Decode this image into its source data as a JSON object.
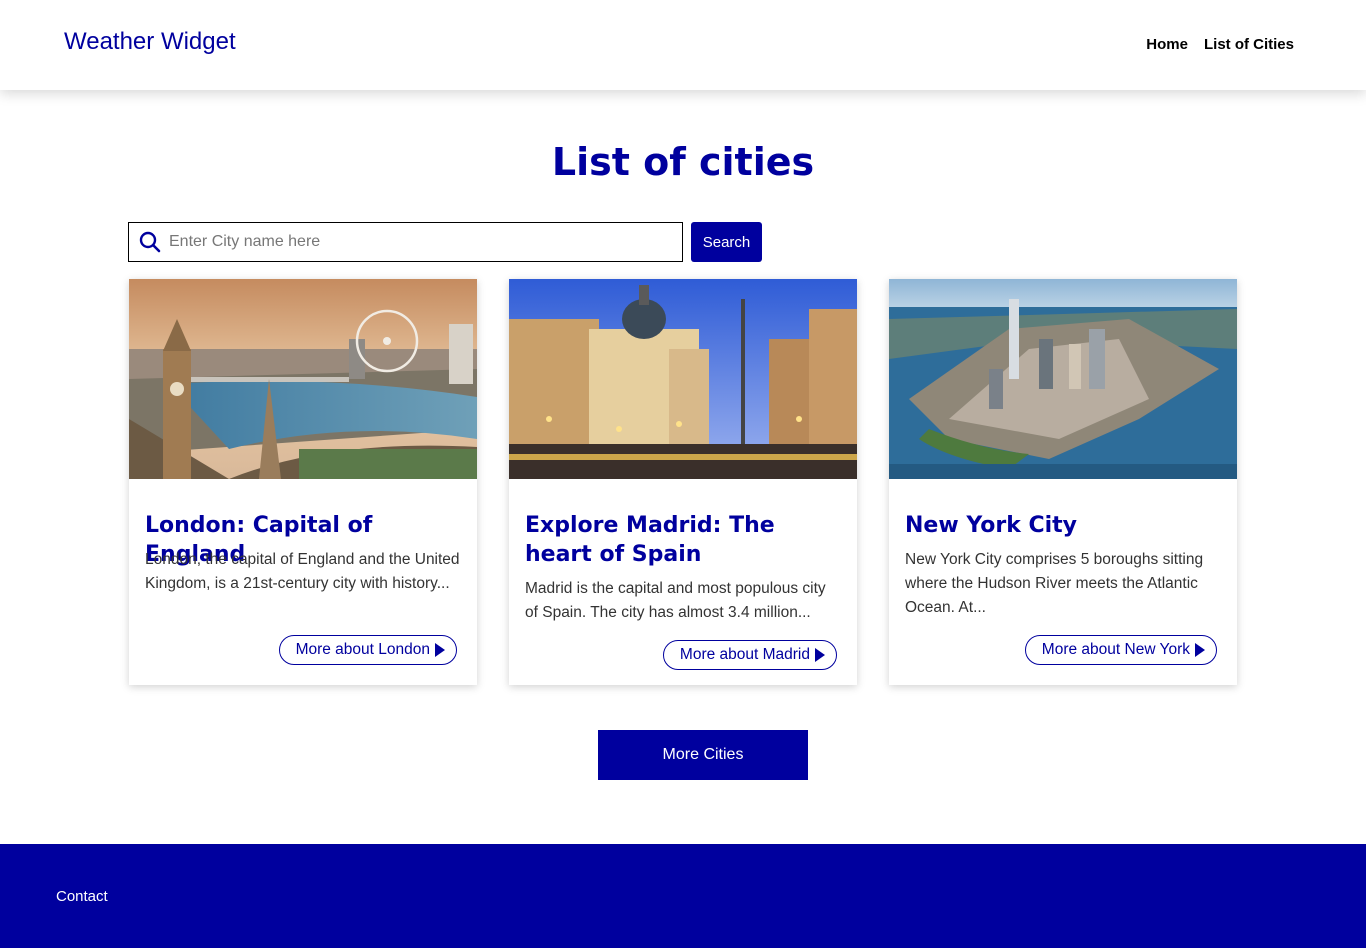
{
  "header": {
    "brand": "Weather Widget",
    "nav": [
      "Home",
      "List of Cities"
    ]
  },
  "main": {
    "title": "List of cities",
    "search": {
      "placeholder": "Enter City name here",
      "value": "",
      "button_label": "Search"
    },
    "cards": [
      {
        "title": "London: Capital of England",
        "text": "London, the capital of England and the United Kingdom, is a 21st-century city with history...",
        "link_label": "More about London"
      },
      {
        "title": "Explore Madrid: The heart of Spain",
        "text": "Madrid is the capital and most populous city of Spain. The city has almost 3.4 million...",
        "link_label": "More about Madrid"
      },
      {
        "title": "New York City",
        "text": "New York City comprises 5 boroughs sitting where the Hudson River meets the Atlantic Ocean. At...",
        "link_label": "More about New York"
      }
    ],
    "more_button": "More Cities"
  },
  "footer": {
    "contact": "Contact"
  },
  "colors": {
    "brand": "#00009e",
    "background": "#ffffff"
  },
  "icons": {
    "search": "search-icon",
    "link_arrow": "play-arrow-icon"
  }
}
